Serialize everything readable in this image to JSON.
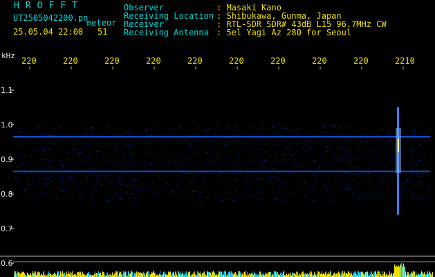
{
  "header": {
    "brand": "HROFFT",
    "filename": "UT2505042200.pn",
    "type_label": "meteor",
    "datetime": "25.05.04 22:00",
    "count": "51",
    "fields": [
      {
        "label": "Observer",
        "value": ": Masaki Kano"
      },
      {
        "label": "Receiving Location",
        "value": ": Shibukawa, Gunma, Japan"
      },
      {
        "label": "Receiver",
        "value": ": RTL-SDR SDR# 43dB L15 96.7MHz CW"
      },
      {
        "label": "Receiving Antenna",
        "value": ": 5el Yagi Az 280 for Seoul"
      }
    ]
  },
  "spectrogram": {
    "y_unit": "kHz",
    "x_tick_labels": [
      "220",
      "220",
      "220",
      "220",
      "220",
      "220",
      "220",
      "220",
      "220",
      "2210"
    ],
    "y_tick_labels": [
      "1.1",
      "1.0",
      "0.9",
      "0.8",
      "0.7",
      "0.6"
    ],
    "y_range_khz": [
      0.58,
      1.15
    ],
    "horizontal_signals_khz": [
      0.965,
      0.865
    ],
    "meteor_echo": {
      "center_khz": 0.93,
      "extent_khz": [
        0.74,
        1.05
      ]
    },
    "colors": {
      "background": "#000000",
      "axis_text": "#e8e8e8",
      "tick_text": "#f0e000",
      "header_label": "#00d8d8",
      "header_value": "#f0e000",
      "signal": "#2060ff",
      "noise_floor": "#000a46",
      "activity_bar": "#f0e000",
      "activity_bar_low": "#00c8ff"
    }
  }
}
